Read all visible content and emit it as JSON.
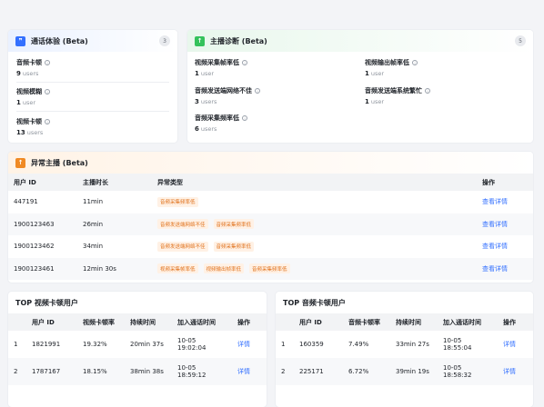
{
  "call_experience": {
    "title": "通话体验 (Beta)",
    "count": "3",
    "metrics": [
      {
        "label": "音频卡顿",
        "value": "9",
        "unit": "users"
      },
      {
        "label": "视频模糊",
        "value": "1",
        "unit": "user"
      },
      {
        "label": "视频卡顿",
        "value": "13",
        "unit": "users"
      }
    ]
  },
  "host_diagnosis": {
    "title": "主播诊断 (Beta)",
    "count": "5",
    "metrics": [
      {
        "label": "视频采集帧率低",
        "value": "1",
        "unit": "user"
      },
      {
        "label": "音频发送端网络不佳",
        "value": "3",
        "unit": "users"
      },
      {
        "label": "音频采集频率低",
        "value": "6",
        "unit": "users"
      },
      {
        "label": "视频输出帧率低",
        "value": "1",
        "unit": "user"
      },
      {
        "label": "音频发送端系统繁忙",
        "value": "1",
        "unit": "user"
      }
    ]
  },
  "abnormal_hosts": {
    "title": "异常主播 (Beta)",
    "columns": [
      "用户 ID",
      "主播时长",
      "异常类型",
      "操作"
    ],
    "rows": [
      {
        "id": "447191",
        "duration": "11min",
        "types": [
          "音频采集频率低"
        ],
        "action": "查看详情"
      },
      {
        "id": "1900123463",
        "duration": "26min",
        "types": [
          "音频发送端网络不佳",
          "音频采集频率低"
        ],
        "action": "查看详情"
      },
      {
        "id": "1900123462",
        "duration": "34min",
        "types": [
          "音频发送端网络不佳",
          "音频采集频率低"
        ],
        "action": "查看详情"
      },
      {
        "id": "1900123461",
        "duration": "12min 30s",
        "types": [
          "视频采集帧率低",
          "视频输出帧率低",
          "音频采集频率低"
        ],
        "action": "查看详情"
      }
    ]
  },
  "top_video": {
    "title": "TOP 视频卡顿用户",
    "columns": [
      "",
      "用户 ID",
      "视频卡顿率",
      "持续时间",
      "加入通话时间",
      "操作"
    ],
    "rows": [
      {
        "rank": "1",
        "id": "1821991",
        "rate": "19.32%",
        "duration": "20min 37s",
        "join_date": "10-05",
        "join_time": "19:02:04",
        "action": "详情"
      },
      {
        "rank": "2",
        "id": "1787167",
        "rate": "18.15%",
        "duration": "38min 38s",
        "join_date": "10-05",
        "join_time": "18:59:12",
        "action": "详情"
      }
    ]
  },
  "top_audio": {
    "title": "TOP 音频卡顿用户",
    "columns": [
      "",
      "用户 ID",
      "音频卡顿率",
      "持续时间",
      "加入通话时间",
      "操作"
    ],
    "rows": [
      {
        "rank": "1",
        "id": "160359",
        "rate": "7.49%",
        "duration": "33min 27s",
        "join_date": "10-05",
        "join_time": "18:55:04",
        "action": "详情"
      },
      {
        "rank": "2",
        "id": "225171",
        "rate": "6.72%",
        "duration": "39min 19s",
        "join_date": "10-05",
        "join_time": "18:58:32",
        "action": "详情"
      }
    ]
  },
  "colors": {
    "accent": "#3370ff",
    "tag_bg": "#fff1e5",
    "tag_text": "#e0711b"
  }
}
